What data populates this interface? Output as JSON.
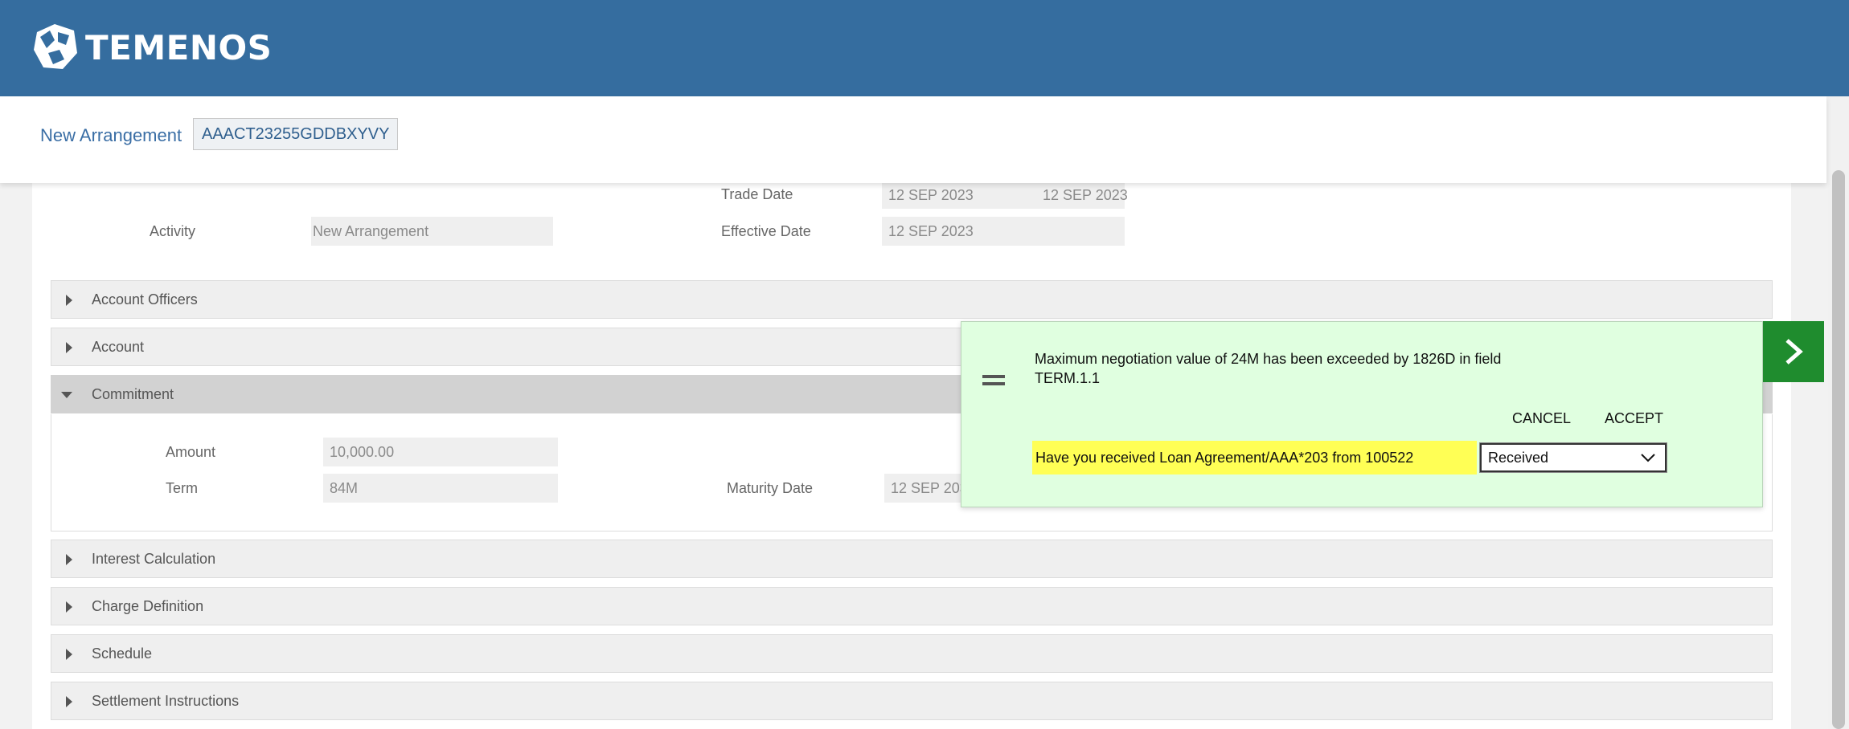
{
  "header": {
    "brand": "TEMENOS"
  },
  "subheader": {
    "title": "New Arrangement",
    "arrangement_id": "AAACT23255GDDBXYVY"
  },
  "activity_fields": {
    "activity_label": "Activity",
    "activity_value": "New Arrangement",
    "trade_date_label": "Trade Date",
    "trade_date_value": "12 SEP 2023",
    "trade_date_value_2": "12 SEP 2023",
    "effective_date_label": "Effective Date",
    "effective_date_value": "12 SEP 2023"
  },
  "sections": {
    "account_officers": "Account Officers",
    "account": "Account",
    "commitment": "Commitment",
    "interest_calculation": "Interest Calculation",
    "charge_definition": "Charge Definition",
    "schedule": "Schedule",
    "settlement_instructions": "Settlement Instructions"
  },
  "commitment": {
    "amount_label": "Amount",
    "amount_value": "10,000.00",
    "term_label": "Term",
    "term_value": "84M",
    "maturity_date_label": "Maturity Date",
    "maturity_date_value": "12 SEP 2030"
  },
  "override_dialog": {
    "message": "Maximum negotiation value of 24M has been exceeded by 1826D in field TERM.1.1",
    "cancel_label": "CANCEL",
    "accept_label": "ACCEPT",
    "question": "Have you received Loan Agreement/AAA*203 from 100522",
    "response_selected": "Received"
  },
  "colors": {
    "header_bg": "#356d9f",
    "dialog_bg": "#e0ffe0",
    "question_highlight": "#ffff55",
    "next_button": "#1f8c2e"
  },
  "icons": {
    "logo": "globe-logo-icon",
    "drag": "drag-handle-icon",
    "dropdown": "chevron-down-icon",
    "next": "chevron-right-icon"
  }
}
